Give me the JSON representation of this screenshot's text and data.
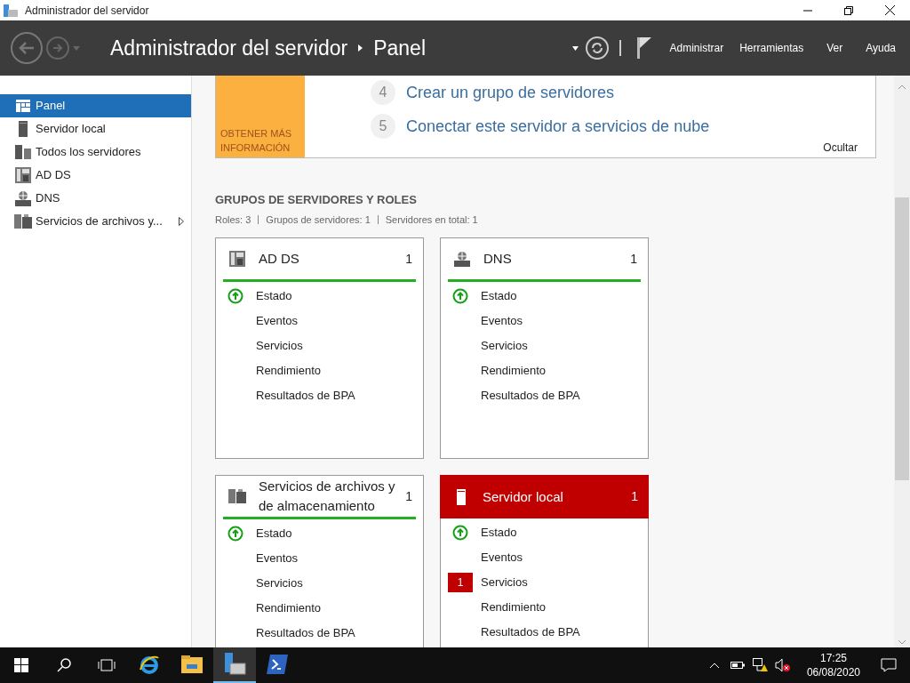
{
  "window": {
    "title": "Administrador del servidor"
  },
  "header": {
    "breadcrumb": [
      "Administrador del servidor",
      "Panel"
    ],
    "menus": [
      "Administrar",
      "Herramientas",
      "Ver",
      "Ayuda"
    ]
  },
  "sidebar": {
    "items": [
      {
        "label": "Panel",
        "selected": true,
        "has_submenu": false
      },
      {
        "label": "Servidor local",
        "selected": false,
        "has_submenu": false
      },
      {
        "label": "Todos los servidores",
        "selected": false,
        "has_submenu": false
      },
      {
        "label": "AD DS",
        "selected": false,
        "has_submenu": false
      },
      {
        "label": "DNS",
        "selected": false,
        "has_submenu": false
      },
      {
        "label": "Servicios de archivos y...",
        "selected": false,
        "has_submenu": true
      }
    ]
  },
  "welcome": {
    "learn_more": "OBTENER MÁS INFORMACIÓN",
    "steps": [
      {
        "number": "4",
        "label": "Crear un grupo de servidores"
      },
      {
        "number": "5",
        "label": "Conectar este servidor a servicios de nube"
      }
    ],
    "hide": "Ocultar"
  },
  "section": {
    "title": "GRUPOS DE SERVIDORES Y ROLES",
    "stats": [
      "Roles: 3",
      "Grupos de servidores: 1",
      "Servidores en total: 1"
    ]
  },
  "tiles": [
    {
      "name": "AD DS",
      "count": "1",
      "alert": false,
      "rows": [
        {
          "label": "Estado",
          "ok": true
        },
        {
          "label": "Eventos",
          "ok": false
        },
        {
          "label": "Servicios",
          "ok": false
        },
        {
          "label": "Rendimiento",
          "ok": false
        },
        {
          "label": "Resultados de BPA",
          "ok": false
        }
      ]
    },
    {
      "name": "DNS",
      "count": "1",
      "alert": false,
      "rows": [
        {
          "label": "Estado",
          "ok": true
        },
        {
          "label": "Eventos",
          "ok": false
        },
        {
          "label": "Servicios",
          "ok": false
        },
        {
          "label": "Rendimiento",
          "ok": false
        },
        {
          "label": "Resultados de BPA",
          "ok": false
        }
      ]
    },
    {
      "name": "Servicios de archivos y de almacenamiento",
      "count": "1",
      "alert": false,
      "rows": [
        {
          "label": "Estado",
          "ok": true
        },
        {
          "label": "Eventos",
          "ok": false
        },
        {
          "label": "Servicios",
          "ok": false
        },
        {
          "label": "Rendimiento",
          "ok": false
        },
        {
          "label": "Resultados de BPA",
          "ok": false
        }
      ]
    },
    {
      "name": "Servidor local",
      "count": "1",
      "alert": true,
      "rows": [
        {
          "label": "Estado",
          "ok": true
        },
        {
          "label": "Eventos",
          "ok": false
        },
        {
          "label": "Servicios",
          "ok": false,
          "badge": "1"
        },
        {
          "label": "Rendimiento",
          "ok": false
        },
        {
          "label": "Resultados de BPA",
          "ok": false
        }
      ]
    }
  ],
  "taskbar": {
    "apps": [
      {
        "kind": "ie",
        "active": false
      },
      {
        "kind": "folder",
        "active": false
      },
      {
        "kind": "servermanager",
        "active": true
      },
      {
        "kind": "powershell",
        "active": false
      }
    ],
    "time": "17:25",
    "date": "06/08/2020"
  }
}
